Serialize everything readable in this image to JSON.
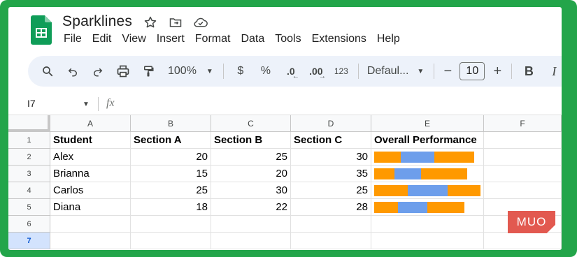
{
  "doc": {
    "title": "Sparklines"
  },
  "menu": [
    "File",
    "Edit",
    "View",
    "Insert",
    "Format",
    "Data",
    "Tools",
    "Extensions",
    "Help"
  ],
  "toolbar": {
    "zoom": "100%",
    "currency": "$",
    "percent": "%",
    "decrease_decimal": ".0",
    "increase_decimal": ".00",
    "number_format": "123",
    "font": "Defaul...",
    "font_size": "10",
    "minus": "−",
    "plus": "+",
    "bold": "B",
    "italic": "I"
  },
  "formula_bar": {
    "cell_ref": "I7",
    "fx": "fx"
  },
  "columns": [
    "A",
    "B",
    "C",
    "D",
    "E",
    "F"
  ],
  "rows": [
    "1",
    "2",
    "3",
    "4",
    "5",
    "6",
    "7"
  ],
  "headers": [
    "Student",
    "Section A",
    "Section B",
    "Section C",
    "Overall Performance"
  ],
  "students": [
    {
      "name": "Alex",
      "a": "20",
      "b": "25",
      "c": "30"
    },
    {
      "name": "Brianna",
      "a": "15",
      "b": "20",
      "c": "35"
    },
    {
      "name": "Carlos",
      "a": "25",
      "b": "30",
      "c": "25"
    },
    {
      "name": "Diana",
      "a": "18",
      "b": "22",
      "c": "28"
    }
  ],
  "sparkline": {
    "colors": [
      "#ff9900",
      "#6d9eeb",
      "#ff9900"
    ],
    "max_total": 80,
    "bars": [
      [
        20,
        25,
        30
      ],
      [
        15,
        20,
        35
      ],
      [
        25,
        30,
        25
      ],
      [
        18,
        22,
        28
      ]
    ]
  },
  "watermark": "MUO",
  "colors": {
    "frame": "#23a54a",
    "sheets_green": "#0f9d58",
    "selected_row": "#d3e3fd"
  }
}
